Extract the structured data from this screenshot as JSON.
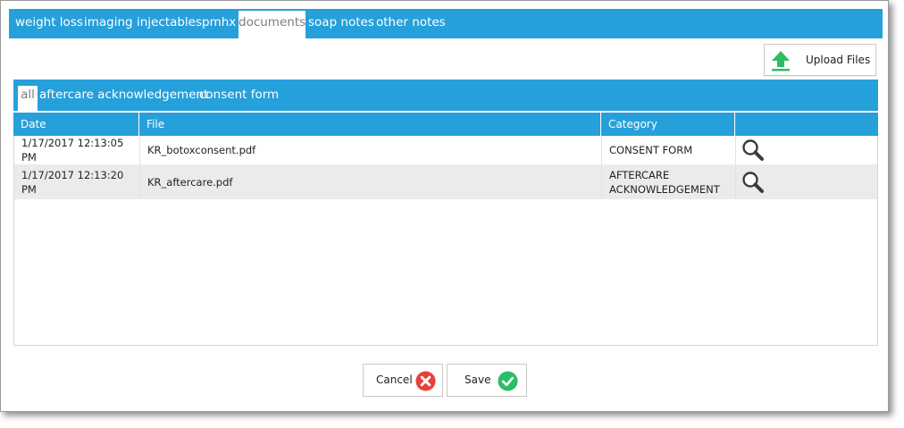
{
  "tabs": [
    {
      "label": "weight loss"
    },
    {
      "label": "imaging"
    },
    {
      "label": "injectables"
    },
    {
      "label": "pmhx"
    },
    {
      "label": "documents"
    },
    {
      "label": "soap notes"
    },
    {
      "label": "other notes"
    }
  ],
  "active_tab": "documents",
  "upload": {
    "label": "Upload Files",
    "icon": "upload-arrow-icon"
  },
  "filters": [
    {
      "label": "all"
    },
    {
      "label": "aftercare acknowledgement"
    },
    {
      "label": "consent form"
    }
  ],
  "active_filter": "all",
  "grid": {
    "columns": [
      "Date",
      "File",
      "Category",
      ""
    ],
    "rows": [
      {
        "date": "1/17/2017 12:13:05 PM",
        "file": "KR_botoxconsent.pdf",
        "category": "CONSENT FORM",
        "action_icon": "magnifier-icon"
      },
      {
        "date": "1/17/2017 12:13:20 PM",
        "file": "KR_aftercare.pdf",
        "category": "AFTERCARE ACKNOWLEDGEMENT",
        "action_icon": "magnifier-icon"
      }
    ]
  },
  "footer": {
    "cancel_label": "Cancel",
    "save_label": "Save",
    "cancel_icon": "x-circle-icon",
    "save_icon": "check-circle-icon"
  },
  "colors": {
    "accent": "#26a0da",
    "cancel": "#e8403a",
    "save": "#2dbd65",
    "upload_arrow": "#2dbd65",
    "row_alt": "#ebebeb"
  }
}
